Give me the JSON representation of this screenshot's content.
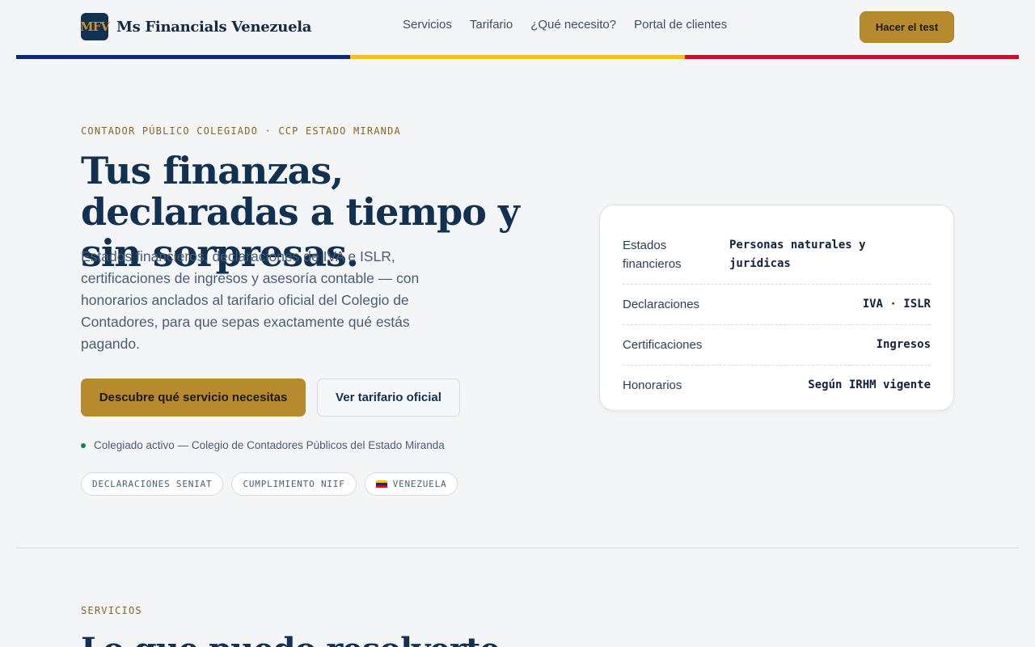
{
  "header": {
    "logo_text": "MFV",
    "brand_name": "Ms Financials Venezuela",
    "nav": [
      {
        "label": "Servicios"
      },
      {
        "label": "Tarifario"
      },
      {
        "label": "¿Qué necesito?"
      },
      {
        "label": "Portal de clientes"
      }
    ],
    "cta_label": "Hacer el test"
  },
  "colors": {
    "flag_blue": "#0a2a78",
    "flag_yellow": "#f1c21b",
    "flag_red": "#c8102e",
    "accent_gold": "#b88a2e",
    "navy": "#12304f"
  },
  "hero": {
    "eyebrow": "CONTADOR PÚBLICO COLEGIADO · CCP ESTADO MIRANDA",
    "title": "Tus finanzas, declaradas a tiempo y sin sorpresas.",
    "subtitle": "Estados financieros, declaraciones de IVA e ISLR, certificaciones de ingresos y asesoría contable — con honorarios anclados al tarifario oficial del Colegio de Contadores, para que sepas exactamente qué estás pagando.",
    "primary_button": "Descubre qué servicio necesitas",
    "secondary_button": "Ver tarifario oficial",
    "status_text": "Colegiado activo — Colegio de Contadores Públicos del Estado Miranda",
    "chips": [
      {
        "label": "DECLARACIONES SENIAT"
      },
      {
        "label": "CUMPLIMIENTO NIIF"
      },
      {
        "label": "VENEZUELA",
        "icon": "venezuela-flag-icon"
      }
    ]
  },
  "card": {
    "rows": [
      {
        "label": "Estados financieros",
        "value": "Personas naturales y jurídicas"
      },
      {
        "label": "Declaraciones",
        "value": "IVA · ISLR"
      },
      {
        "label": "Certificaciones",
        "value": "Ingresos"
      },
      {
        "label": "Honorarios",
        "value": "Según IRHM vigente"
      }
    ]
  },
  "services": {
    "eyebrow": "SERVICIOS",
    "title": "Lo que puedo resolverte"
  }
}
